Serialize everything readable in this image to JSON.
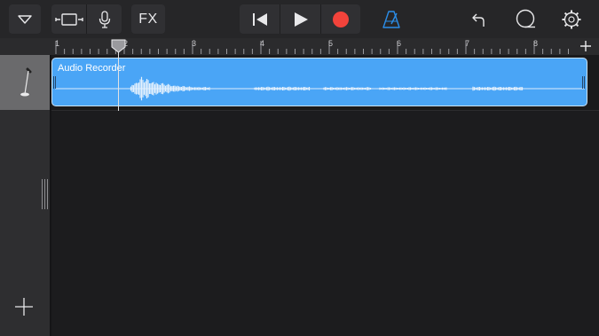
{
  "toolbar": {
    "menu_icon": "triangle-down-icon",
    "browser_icon": "track-view-icon",
    "instrument_icon": "microphone-icon",
    "fx_label": "FX",
    "rewind_icon": "go-to-beginning-icon",
    "play_icon": "play-icon",
    "record_icon": "record-icon",
    "metronome_icon": "metronome-icon",
    "undo_icon": "undo-icon",
    "loop_icon": "loop-browser-icon",
    "settings_icon": "gear-icon",
    "colors": {
      "record": "#f2433b",
      "metronome": "#2b8de8"
    }
  },
  "ruler": {
    "bars": [
      "1",
      "2",
      "3",
      "4",
      "5",
      "6",
      "7",
      "8"
    ],
    "add_icon": "plus-icon"
  },
  "track": {
    "icon": "audio-recorder-microphone-icon",
    "region_name": "Audio Recorder",
    "region_color": "#4aa5f6"
  },
  "sidebar": {
    "add_track_icon": "plus-icon",
    "resize_icon": "grip-handle-icon"
  }
}
